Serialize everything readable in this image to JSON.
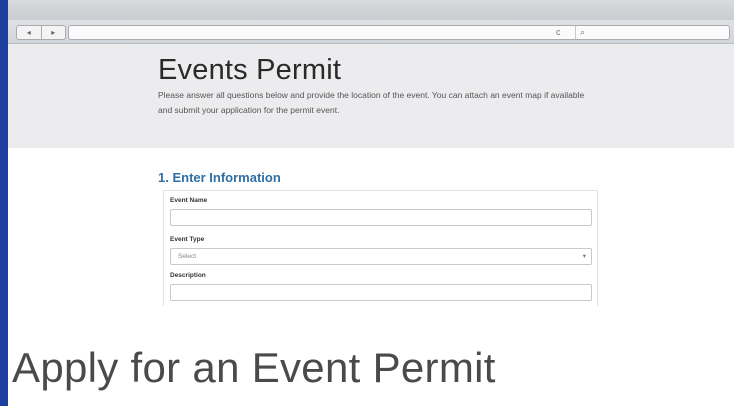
{
  "browser": {
    "back_icon": "◂",
    "forward_icon": "▸",
    "reload_icon": "c",
    "search_icon": "⌕"
  },
  "page": {
    "title": "Events Permit",
    "intro": "Please answer all questions below and provide the location of the event.  You can attach an event map if available and submit your application for the permit event.",
    "section_title": "1. Enter Information",
    "form": {
      "event_name_label": "Event Name",
      "event_name_value": "",
      "event_type_label": "Event Type",
      "event_type_selected": "Select",
      "description_label": "Description"
    }
  },
  "caption": "Apply for an Event Permit"
}
